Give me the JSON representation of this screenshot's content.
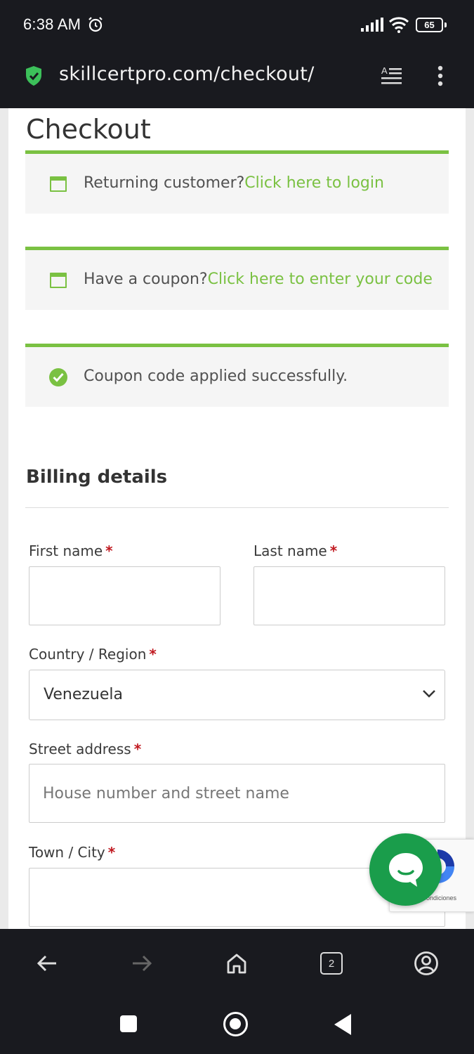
{
  "status_bar": {
    "time": "6:38 AM",
    "battery": "65",
    "icons": [
      "alarm-icon",
      "signal-icon",
      "wifi-icon",
      "battery-icon"
    ]
  },
  "browser": {
    "url": "skillcertpro.com/checkout/",
    "security_icon": "shield-check-icon",
    "reader_mode_icon": "reader-mode-icon",
    "menu_icon": "overflow-menu-icon",
    "tabs_count": "2"
  },
  "page": {
    "title": "Checkout",
    "accent_color": "#7ac142",
    "notices": [
      {
        "text": "Returning customer?",
        "link": "Click here to login"
      },
      {
        "text": "Have a coupon?",
        "link": "Click here to enter your code"
      },
      {
        "text": "Coupon code applied successfully."
      }
    ],
    "billing": {
      "heading": "Billing details",
      "first_name_label": "First name",
      "last_name_label": "Last name",
      "country_label": "Country / Region",
      "country_value": "Venezuela",
      "street_label": "Street address",
      "street_placeholder": "House number and street name",
      "city_label": "Town / City",
      "required_marker": "*"
    }
  },
  "recaptcha": {
    "text": "- Condiciones"
  },
  "chat_button_color": "#1a9d4b"
}
